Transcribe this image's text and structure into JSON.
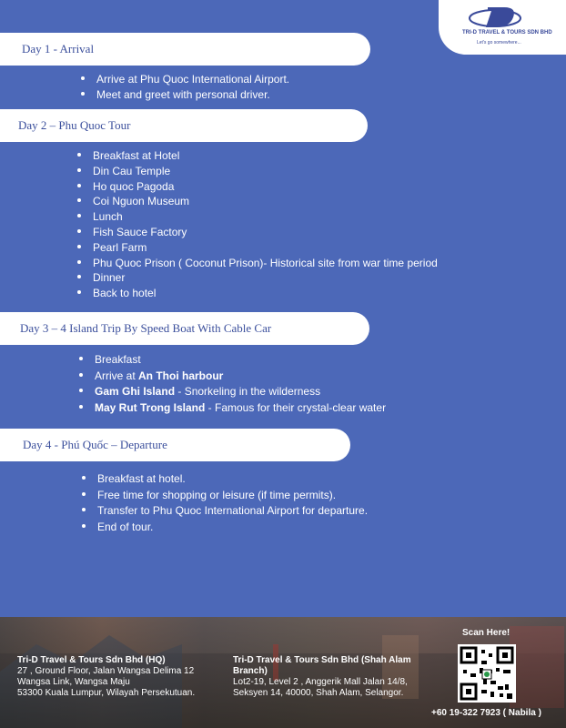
{
  "brand": {
    "name": "TRI-D TRAVEL & TOURS SDN BHD",
    "tagline": "Let's go somewhere..."
  },
  "days": [
    {
      "title": "Day 1 - Arrival",
      "items": [
        {
          "text": "Arrive at Phu Quoc International Airport."
        },
        {
          "text": "Meet and greet with personal driver."
        }
      ]
    },
    {
      "title": "Day 2 – Phu Quoc Tour",
      "items": [
        {
          "text": "Breakfast at Hotel"
        },
        {
          "text": "Din Cau Temple"
        },
        {
          "text": "Ho quoc Pagoda"
        },
        {
          "text": "Coi Nguon Museum"
        },
        {
          "text": "Lunch"
        },
        {
          "text": "Fish Sauce Factory"
        },
        {
          "text": "Pearl Farm"
        },
        {
          "text": "Phu Quoc Prison ( Coconut Prison)- Historical site from war time period"
        },
        {
          "text": "Dinner"
        },
        {
          "text": "Back to hotel"
        }
      ]
    },
    {
      "title": "Day 3 – 4 Island Trip By Speed Boat With Cable Car",
      "items": [
        {
          "pre": "Breakfast",
          "bold": "",
          "post": ""
        },
        {
          "pre": "Arrive at ",
          "bold": "An Thoi harbour",
          "post": ""
        },
        {
          "pre": "",
          "bold": "Gam Ghi Island",
          "post": " - Snorkeling in the wilderness"
        },
        {
          "pre": "",
          "bold": "May Rut Trong Island",
          "post": " - Famous for their crystal-clear water"
        }
      ]
    },
    {
      "title": "Day 4 - Phú Quốc – Departure",
      "items": [
        {
          "text": "Breakfast at hotel."
        },
        {
          "text": "Free time for shopping or leisure (if time permits)."
        },
        {
          "text": "Transfer to Phu Quoc International Airport for departure."
        },
        {
          "text": "End of tour."
        }
      ]
    }
  ],
  "footer": {
    "hq": {
      "name": "Tri-D Travel & Tours Sdn Bhd (HQ)",
      "line1": "27 , Ground Floor, Jalan Wangsa Delima 12",
      "line2": "Wangsa Link, Wangsa Maju",
      "line3": "53300 Kuala Lumpur, Wilayah Persekutuan."
    },
    "branch": {
      "name": "Tri-D Travel & Tours Sdn Bhd (Shah Alam Branch)",
      "line1": "Lot2-19, Level 2 , Anggerik Mall Jalan 14/8,",
      "line2": "Seksyen 14, 40000, Shah Alam, Selangor."
    },
    "qr_label": "Scan Here!",
    "phone": "+60 19-322 7923 ( Nabila )"
  }
}
